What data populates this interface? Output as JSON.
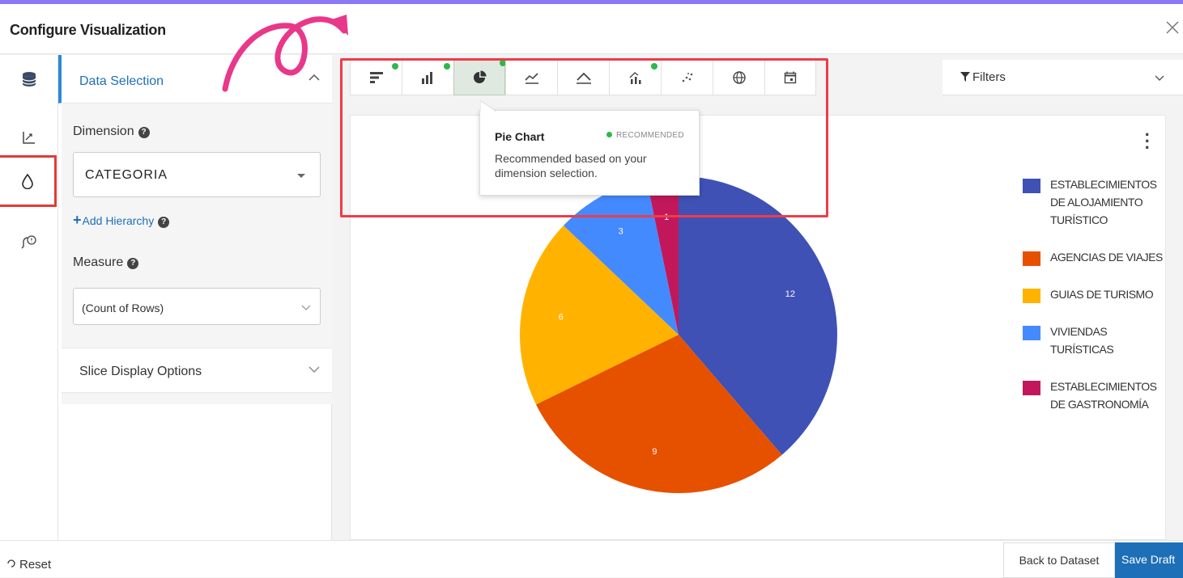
{
  "header": {
    "title": "Configure Visualization",
    "close_icon": "close-icon"
  },
  "icon_rail": [
    "database-icon",
    "axis-chart-icon",
    "drop-icon",
    "comment-icon"
  ],
  "left_panel": {
    "section_label": "Data Selection",
    "dimension_label": "Dimension",
    "dimension_value": "CATEGORIA",
    "add_hierarchy": "Add Hierarchy",
    "measure_label": "Measure",
    "measure_value": "(Count of Rows)",
    "slice_options_label": "Slice Display Options"
  },
  "chart_tabs": [
    {
      "icon": "horizontal-bar-icon",
      "recommended": true
    },
    {
      "icon": "column-chart-icon",
      "recommended": true
    },
    {
      "icon": "pie-chart-icon",
      "recommended": true,
      "active": true
    },
    {
      "icon": "line-chart-icon",
      "recommended": false
    },
    {
      "icon": "area-chart-icon",
      "recommended": false
    },
    {
      "icon": "combo-chart-icon",
      "recommended": true
    },
    {
      "icon": "scatter-chart-icon",
      "recommended": false
    },
    {
      "icon": "globe-icon",
      "recommended": false
    },
    {
      "icon": "calendar-icon",
      "recommended": false
    }
  ],
  "filters_label": "Filters",
  "tooltip": {
    "title": "Pie Chart",
    "badge": "RECOMMENDED",
    "body": "Recommended based on your dimension selection."
  },
  "footer": {
    "reset": "Reset",
    "back": "Back to Dataset",
    "save": "Save Draft"
  },
  "colors": {
    "accent": "#1d6fb8",
    "highlight": "#ef3b49",
    "arrow": "#e8388a",
    "recommended": "#2eb84a"
  },
  "chart_data": {
    "type": "pie",
    "title": "",
    "categories": [
      "ESTABLECIMIENTOS DE ALOJAMIENTO TURÍSTICO",
      "AGENCIAS DE VIAJES",
      "GUIAS DE TURISMO",
      "VIVIENDAS TURÍSTICAS",
      "ESTABLECIMIENTOS DE GASTRONOMÍA"
    ],
    "values": [
      12,
      9,
      6,
      3,
      1
    ],
    "colors": [
      "#3f51b5",
      "#e65100",
      "#ffb300",
      "#448aff",
      "#c2185b"
    ],
    "legend_position": "right"
  }
}
